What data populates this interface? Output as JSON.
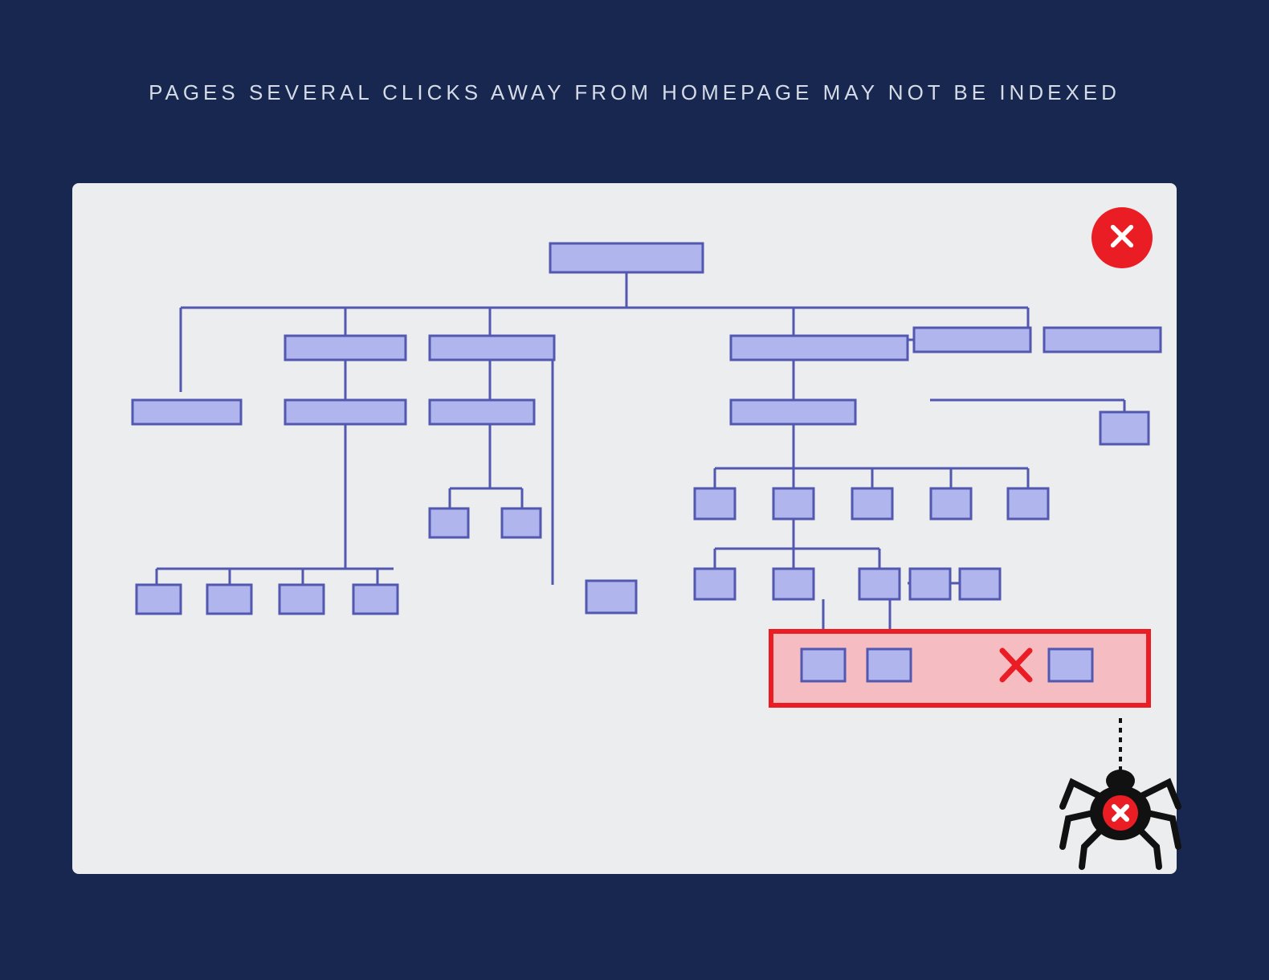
{
  "title": "PAGES SEVERAL CLICKS AWAY FROM HOMEPAGE MAY NOT BE INDEXED",
  "colors": {
    "background": "#17274f",
    "panel": "#ecedef",
    "nodeFill": "#b0b5ed",
    "nodeStroke": "#5258af",
    "error": "#ea1c24",
    "errorFill": "#f5bcc1",
    "spider": "#111111"
  },
  "diagram": {
    "type": "tree",
    "description": "Site hierarchy tree; deepest-level nodes highlighted as not indexed",
    "levels": 6,
    "deepNodesNotIndexed": true
  }
}
